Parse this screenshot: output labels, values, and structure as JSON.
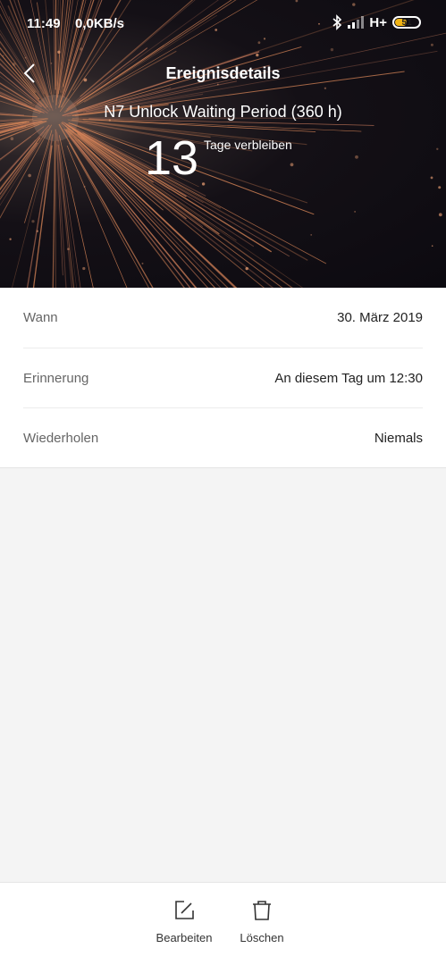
{
  "status_bar": {
    "time": "11:49",
    "net_speed": "0,0KB/s",
    "network_type": "H+",
    "battery_level": "51",
    "battery_percent": 51,
    "icons": [
      "bluetooth-icon",
      "signal-icon"
    ]
  },
  "header": {
    "title": "Ereignisdetails",
    "event_name": "N7 Unlock Waiting Period (360 h)",
    "countdown_number": "13",
    "countdown_suffix": "Tage verbleiben",
    "back_icon": "chevron-left-icon"
  },
  "details": [
    {
      "label": "Wann",
      "value": "30. März 2019"
    },
    {
      "label": "Erinnerung",
      "value": "An diesem Tag um 12:30"
    },
    {
      "label": "Wiederholen",
      "value": "Niemals"
    }
  ],
  "toolbar": {
    "edit_label": "Bearbeiten",
    "delete_label": "Löschen",
    "edit_icon": "edit-icon",
    "delete_icon": "trash-icon"
  },
  "colors": {
    "battery_fill": "#f2b515",
    "spark": "#e08a5a",
    "background": "#f4f4f4"
  }
}
